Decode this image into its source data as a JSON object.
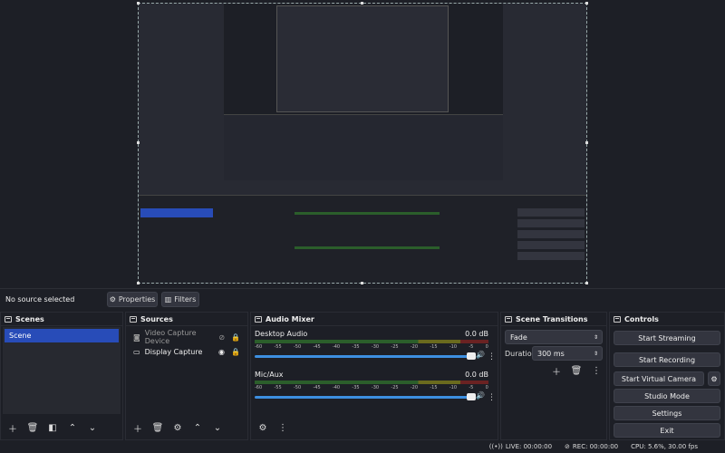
{
  "sourcebar": {
    "no_source": "No source selected",
    "properties": "Properties",
    "filters": "Filters"
  },
  "scenes": {
    "title": "Scenes",
    "items": [
      "Scene"
    ]
  },
  "sources": {
    "title": "Sources",
    "items": [
      {
        "name": "Video Capture Device",
        "icon": "camera-icon",
        "visible": false
      },
      {
        "name": "Display Capture",
        "icon": "monitor-icon",
        "visible": true
      }
    ]
  },
  "mixer": {
    "title": "Audio Mixer",
    "ticks": [
      "-60",
      "-55",
      "-50",
      "-45",
      "-40",
      "-35",
      "-30",
      "-25",
      "-20",
      "-15",
      "-10",
      "-5",
      "0"
    ],
    "channels": [
      {
        "name": "Desktop Audio",
        "db": "0.0 dB"
      },
      {
        "name": "Mic/Aux",
        "db": "0.0 dB"
      }
    ]
  },
  "transitions": {
    "title": "Scene Transitions",
    "selected": "Fade",
    "duration_label": "Duration",
    "duration_value": "300 ms"
  },
  "controls": {
    "title": "Controls",
    "start_streaming": "Start Streaming",
    "start_recording": "Start Recording",
    "start_virtual_camera": "Start Virtual Camera",
    "studio_mode": "Studio Mode",
    "settings": "Settings",
    "exit": "Exit"
  },
  "status": {
    "live": "LIVE: 00:00:00",
    "rec": "REC: 00:00:00",
    "cpu": "CPU: 5.6%, 30.00 fps"
  },
  "colors": {
    "selected": "#284cb8",
    "slider": "#3d8fe0"
  }
}
